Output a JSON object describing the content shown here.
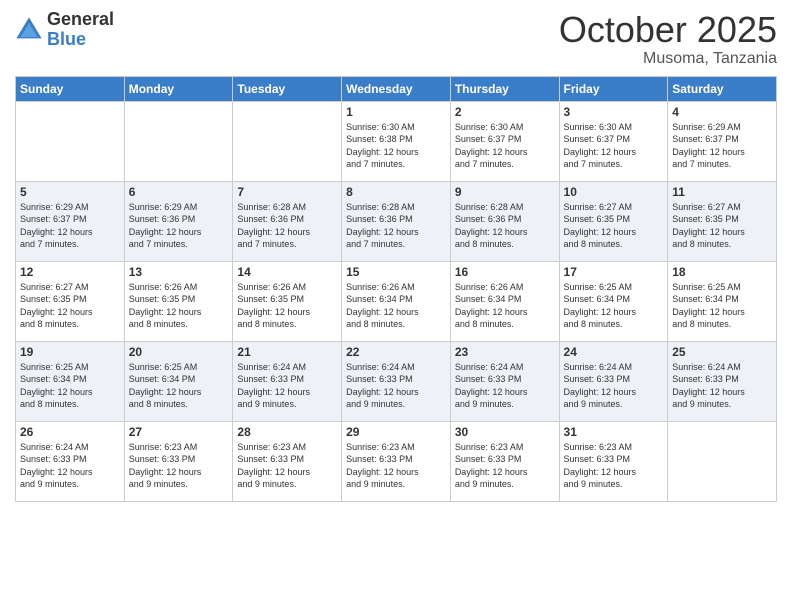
{
  "header": {
    "logo": {
      "general": "General",
      "blue": "Blue"
    },
    "title": "October 2025",
    "location": "Musoma, Tanzania"
  },
  "calendar": {
    "headers": [
      "Sunday",
      "Monday",
      "Tuesday",
      "Wednesday",
      "Thursday",
      "Friday",
      "Saturday"
    ],
    "weeks": [
      [
        {
          "day": "",
          "info": ""
        },
        {
          "day": "",
          "info": ""
        },
        {
          "day": "",
          "info": ""
        },
        {
          "day": "1",
          "info": "Sunrise: 6:30 AM\nSunset: 6:38 PM\nDaylight: 12 hours\nand 7 minutes."
        },
        {
          "day": "2",
          "info": "Sunrise: 6:30 AM\nSunset: 6:37 PM\nDaylight: 12 hours\nand 7 minutes."
        },
        {
          "day": "3",
          "info": "Sunrise: 6:30 AM\nSunset: 6:37 PM\nDaylight: 12 hours\nand 7 minutes."
        },
        {
          "day": "4",
          "info": "Sunrise: 6:29 AM\nSunset: 6:37 PM\nDaylight: 12 hours\nand 7 minutes."
        }
      ],
      [
        {
          "day": "5",
          "info": "Sunrise: 6:29 AM\nSunset: 6:37 PM\nDaylight: 12 hours\nand 7 minutes."
        },
        {
          "day": "6",
          "info": "Sunrise: 6:29 AM\nSunset: 6:36 PM\nDaylight: 12 hours\nand 7 minutes."
        },
        {
          "day": "7",
          "info": "Sunrise: 6:28 AM\nSunset: 6:36 PM\nDaylight: 12 hours\nand 7 minutes."
        },
        {
          "day": "8",
          "info": "Sunrise: 6:28 AM\nSunset: 6:36 PM\nDaylight: 12 hours\nand 7 minutes."
        },
        {
          "day": "9",
          "info": "Sunrise: 6:28 AM\nSunset: 6:36 PM\nDaylight: 12 hours\nand 8 minutes."
        },
        {
          "day": "10",
          "info": "Sunrise: 6:27 AM\nSunset: 6:35 PM\nDaylight: 12 hours\nand 8 minutes."
        },
        {
          "day": "11",
          "info": "Sunrise: 6:27 AM\nSunset: 6:35 PM\nDaylight: 12 hours\nand 8 minutes."
        }
      ],
      [
        {
          "day": "12",
          "info": "Sunrise: 6:27 AM\nSunset: 6:35 PM\nDaylight: 12 hours\nand 8 minutes."
        },
        {
          "day": "13",
          "info": "Sunrise: 6:26 AM\nSunset: 6:35 PM\nDaylight: 12 hours\nand 8 minutes."
        },
        {
          "day": "14",
          "info": "Sunrise: 6:26 AM\nSunset: 6:35 PM\nDaylight: 12 hours\nand 8 minutes."
        },
        {
          "day": "15",
          "info": "Sunrise: 6:26 AM\nSunset: 6:34 PM\nDaylight: 12 hours\nand 8 minutes."
        },
        {
          "day": "16",
          "info": "Sunrise: 6:26 AM\nSunset: 6:34 PM\nDaylight: 12 hours\nand 8 minutes."
        },
        {
          "day": "17",
          "info": "Sunrise: 6:25 AM\nSunset: 6:34 PM\nDaylight: 12 hours\nand 8 minutes."
        },
        {
          "day": "18",
          "info": "Sunrise: 6:25 AM\nSunset: 6:34 PM\nDaylight: 12 hours\nand 8 minutes."
        }
      ],
      [
        {
          "day": "19",
          "info": "Sunrise: 6:25 AM\nSunset: 6:34 PM\nDaylight: 12 hours\nand 8 minutes."
        },
        {
          "day": "20",
          "info": "Sunrise: 6:25 AM\nSunset: 6:34 PM\nDaylight: 12 hours\nand 8 minutes."
        },
        {
          "day": "21",
          "info": "Sunrise: 6:24 AM\nSunset: 6:33 PM\nDaylight: 12 hours\nand 9 minutes."
        },
        {
          "day": "22",
          "info": "Sunrise: 6:24 AM\nSunset: 6:33 PM\nDaylight: 12 hours\nand 9 minutes."
        },
        {
          "day": "23",
          "info": "Sunrise: 6:24 AM\nSunset: 6:33 PM\nDaylight: 12 hours\nand 9 minutes."
        },
        {
          "day": "24",
          "info": "Sunrise: 6:24 AM\nSunset: 6:33 PM\nDaylight: 12 hours\nand 9 minutes."
        },
        {
          "day": "25",
          "info": "Sunrise: 6:24 AM\nSunset: 6:33 PM\nDaylight: 12 hours\nand 9 minutes."
        }
      ],
      [
        {
          "day": "26",
          "info": "Sunrise: 6:24 AM\nSunset: 6:33 PM\nDaylight: 12 hours\nand 9 minutes."
        },
        {
          "day": "27",
          "info": "Sunrise: 6:23 AM\nSunset: 6:33 PM\nDaylight: 12 hours\nand 9 minutes."
        },
        {
          "day": "28",
          "info": "Sunrise: 6:23 AM\nSunset: 6:33 PM\nDaylight: 12 hours\nand 9 minutes."
        },
        {
          "day": "29",
          "info": "Sunrise: 6:23 AM\nSunset: 6:33 PM\nDaylight: 12 hours\nand 9 minutes."
        },
        {
          "day": "30",
          "info": "Sunrise: 6:23 AM\nSunset: 6:33 PM\nDaylight: 12 hours\nand 9 minutes."
        },
        {
          "day": "31",
          "info": "Sunrise: 6:23 AM\nSunset: 6:33 PM\nDaylight: 12 hours\nand 9 minutes."
        },
        {
          "day": "",
          "info": ""
        }
      ]
    ]
  }
}
